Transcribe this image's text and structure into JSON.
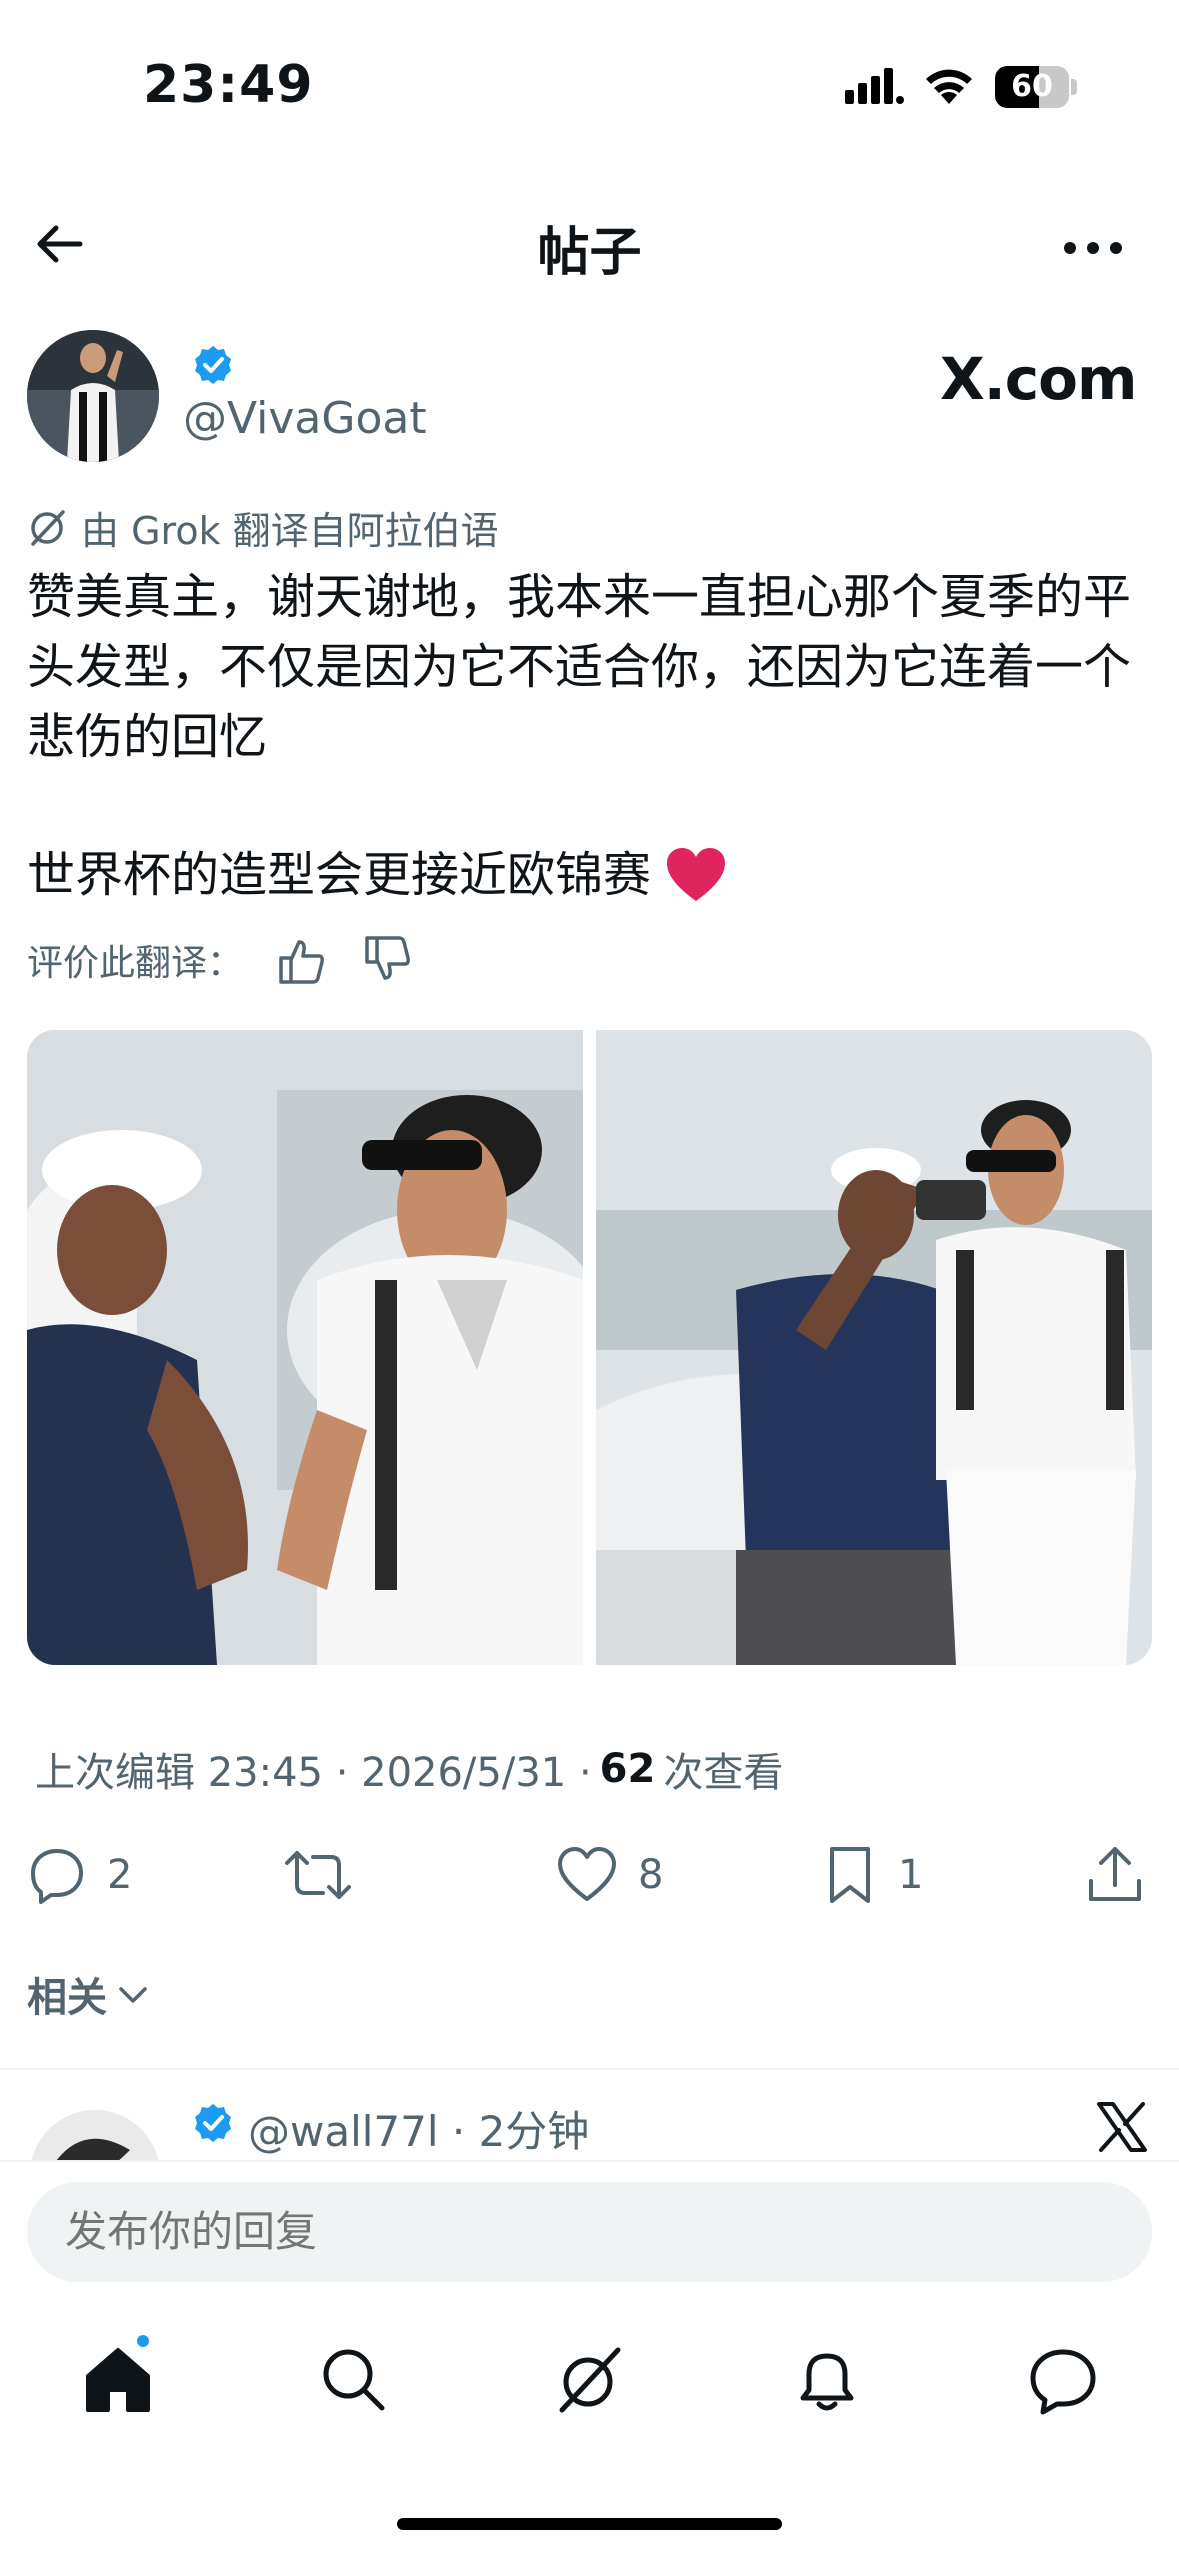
{
  "status_bar": {
    "time": "23:49",
    "battery": "60",
    "battery_level": 0.6
  },
  "header": {
    "title": "帖子"
  },
  "author": {
    "handle": "@VivaGoat",
    "site_logo": "X.com"
  },
  "translation_note": "由 Grok 翻译自阿拉伯语",
  "post": {
    "text": "赞美真主，谢天谢地，我本来一直担心那个夏季的平头发型，不仅是因为它不适合你，还因为它连着一个悲伤的回忆",
    "text2": "世界杯的造型会更接近欧锦赛",
    "emoji": "red-heart"
  },
  "rate_translation": {
    "label": "评价此翻译："
  },
  "meta": {
    "edited": "上次编辑 23:45 · 2026/5/31 · ",
    "views_count": "62",
    "views_label": "次查看"
  },
  "actions": {
    "replies": "2",
    "reposts": "",
    "likes": "8",
    "bookmarks": "1"
  },
  "related": {
    "label": "相关"
  },
  "next_post": {
    "handle": "@wall77l · 2分钟"
  },
  "reply": {
    "placeholder": "发布你的回复"
  },
  "tabs": [
    "home-icon",
    "search-icon",
    "grok-icon",
    "notifications-icon",
    "messages-icon"
  ],
  "colors": {
    "accent": "#1d9bf0",
    "text": "#0f1419",
    "muted": "#536471",
    "heart": "#e0245e"
  }
}
